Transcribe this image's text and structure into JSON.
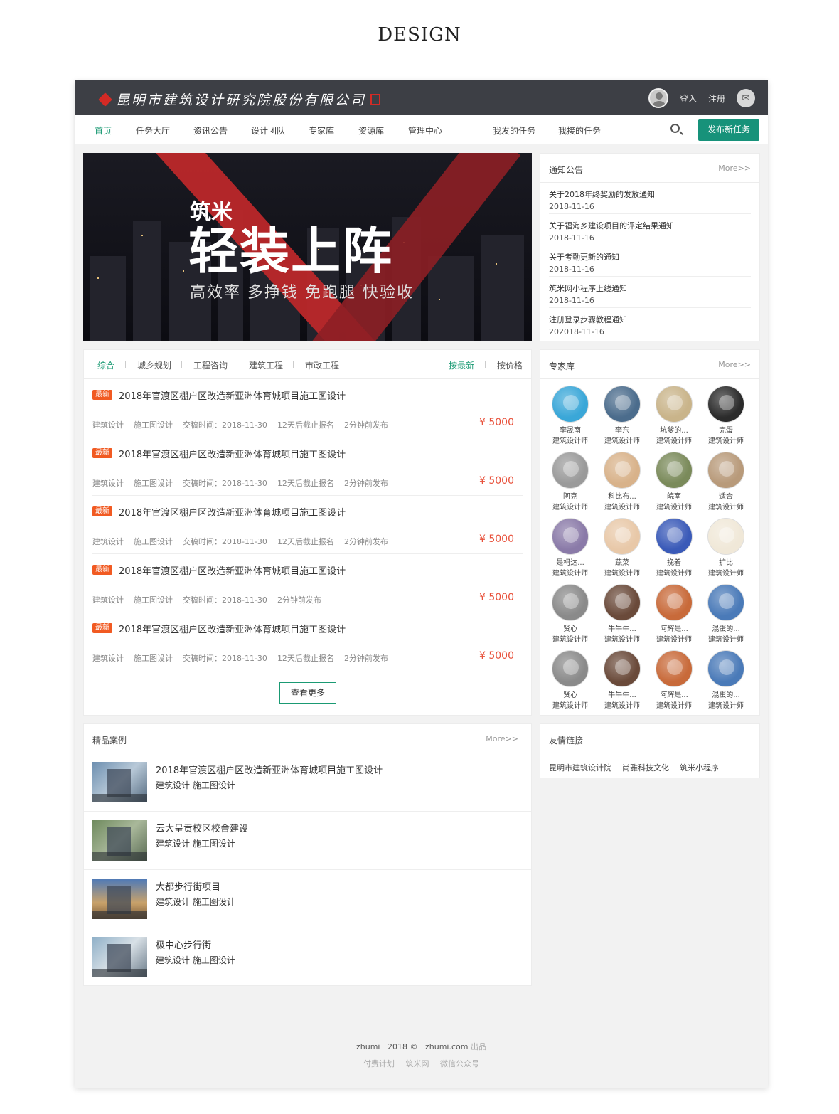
{
  "page_heading": "DESIGN",
  "header": {
    "company_name": "昆明市建筑设计研究院股份有限公司",
    "login": "登入",
    "register": "注册"
  },
  "nav": {
    "items": [
      "首页",
      "任务大厅",
      "资讯公告",
      "设计团队",
      "专家库",
      "资源库",
      "管理中心"
    ],
    "my_items": [
      "我发的任务",
      "我接的任务"
    ],
    "publish_button": "发布新任务",
    "active_color": "#1a9a73"
  },
  "banner": {
    "line1": "筑米",
    "line2": "轻装上阵",
    "line3": "高效率 多挣钱 免跑腿 快验收"
  },
  "notices": {
    "title": "通知公告",
    "more": "More>>",
    "items": [
      {
        "title": "关于2018年终奖励的发放通知",
        "date": "2018-11-16"
      },
      {
        "title": "关于福海乡建设项目的评定结果通知",
        "date": "2018-11-16"
      },
      {
        "title": "关于考勤更新的通知",
        "date": "2018-11-16"
      },
      {
        "title": "筑米网小程序上线通知",
        "date": "2018-11-16"
      },
      {
        "title": "注册登录步骤教程通知",
        "date": "202018-11-16"
      }
    ]
  },
  "tasks": {
    "filters": [
      "综合",
      "城乡规划",
      "工程咨询",
      "建筑工程",
      "市政工程"
    ],
    "sort": [
      "按最新",
      "按价格"
    ],
    "items": [
      {
        "badge": "最新",
        "title": "2018年官渡区棚户区改造新亚洲体育城项目施工图设计",
        "meta": [
          "建筑设计",
          "施工图设计",
          "交稿时间：2018-11-30",
          "12天后截止报名",
          "2分钟前发布"
        ],
        "price": "¥ 5000"
      },
      {
        "badge": "最新",
        "title": "2018年官渡区棚户区改造新亚洲体育城项目施工图设计",
        "meta": [
          "建筑设计",
          "施工图设计",
          "交稿时间：2018-11-30",
          "12天后截止报名",
          "2分钟前发布"
        ],
        "price": "¥ 5000"
      },
      {
        "badge": "最新",
        "title": "2018年官渡区棚户区改造新亚洲体育城项目施工图设计",
        "meta": [
          "建筑设计",
          "施工图设计",
          "交稿时间：2018-11-30",
          "12天后截止报名",
          "2分钟前发布"
        ],
        "price": "¥ 5000"
      },
      {
        "badge": "最新",
        "title": "2018年官渡区棚户区改造新亚洲体育城项目施工图设计",
        "meta": [
          "建筑设计",
          "施工图设计",
          "交稿时间：2018-11-30",
          "2分钟前发布"
        ],
        "price": "¥ 5000"
      },
      {
        "badge": "最新",
        "title": "2018年官渡区棚户区改造新亚洲体育城项目施工图设计",
        "meta": [
          "建筑设计",
          "施工图设计",
          "交稿时间：2018-11-30",
          "12天后截止报名",
          "2分钟前发布"
        ],
        "price": "¥ 5000"
      }
    ],
    "more_button": "查看更多"
  },
  "experts": {
    "title": "专家库",
    "more": "More>>",
    "items": [
      {
        "name": "李晟南",
        "role": "建筑设计师",
        "color": "#3aa7d8"
      },
      {
        "name": "李东",
        "role": "建筑设计师",
        "color": "#4b6c8c"
      },
      {
        "name": "坑爹的...",
        "role": "建筑设计师",
        "color": "#c9b48a"
      },
      {
        "name": "完蛋",
        "role": "建筑设计师",
        "color": "#2b2b2b"
      },
      {
        "name": "阿克",
        "role": "建筑设计师",
        "color": "#9a9a9a"
      },
      {
        "name": "科比布...",
        "role": "建筑设计师",
        "color": "#d8b28a"
      },
      {
        "name": "皖南",
        "role": "建筑设计师",
        "color": "#7a8a5a"
      },
      {
        "name": "适合",
        "role": "建筑设计师",
        "color": "#b89a7a"
      },
      {
        "name": "是柯达...",
        "role": "建筑设计师",
        "color": "#8a7aa8"
      },
      {
        "name": "蔬菜",
        "role": "建筑设计师",
        "color": "#e8c8a8"
      },
      {
        "name": "挽着",
        "role": "建筑设计师",
        "color": "#3a5ab8"
      },
      {
        "name": "扩比",
        "role": "建筑设计师",
        "color": "#f0e8d8"
      },
      {
        "name": "贤心",
        "role": "建筑设计师",
        "color": "#8a8a8a"
      },
      {
        "name": "牛牛牛...",
        "role": "建筑设计师",
        "color": "#6a4a3a"
      },
      {
        "name": "阿辉是...",
        "role": "建筑设计师",
        "color": "#c86a3a"
      },
      {
        "name": "混蛋的...",
        "role": "建筑设计师",
        "color": "#4a7ab8"
      },
      {
        "name": "贤心",
        "role": "建筑设计师",
        "color": "#8a8a8a"
      },
      {
        "name": "牛牛牛...",
        "role": "建筑设计师",
        "color": "#6a4a3a"
      },
      {
        "name": "阿辉是...",
        "role": "建筑设计师",
        "color": "#c86a3a"
      },
      {
        "name": "混蛋的...",
        "role": "建筑设计师",
        "color": "#4a7ab8"
      }
    ]
  },
  "cases": {
    "title": "精品案例",
    "more": "More>>",
    "items": [
      {
        "title": "2018年官渡区棚户区改造新亚洲体育城项目施工图设计",
        "tags": "建筑设计 施工图设计"
      },
      {
        "title": "云大呈贡校区校舍建设",
        "tags": "建筑设计 施工图设计"
      },
      {
        "title": "大都步行街项目",
        "tags": "建筑设计 施工图设计"
      },
      {
        "title": "极中心步行街",
        "tags": "建筑设计 施工图设计"
      }
    ]
  },
  "links": {
    "title": "友情链接",
    "items": [
      "昆明市建筑设计院",
      "尚雅科技文化",
      "筑米小程序"
    ]
  },
  "footer": {
    "brand": "zhumi",
    "year": "2018 ©",
    "domain": "zhumi.com",
    "suffix": "出品",
    "links": [
      "付费计划",
      "筑米网",
      "微信公众号"
    ]
  }
}
